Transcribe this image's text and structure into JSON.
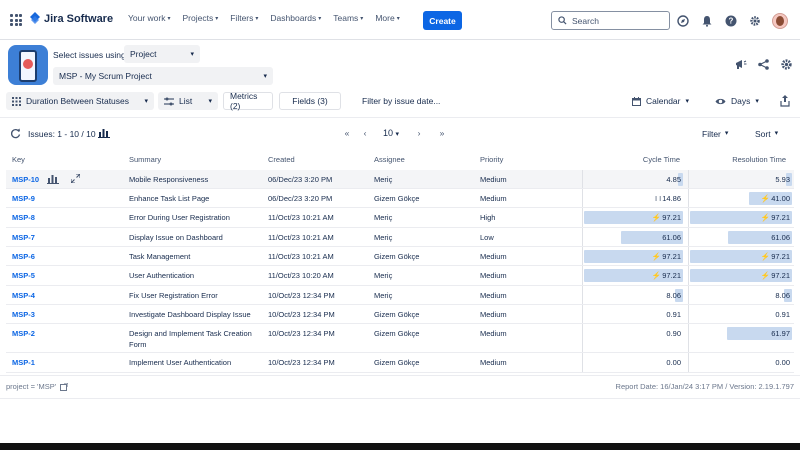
{
  "topnav": {
    "logo_text": "Jira Software",
    "items": [
      {
        "label": "Your work"
      },
      {
        "label": "Projects"
      },
      {
        "label": "Filters"
      },
      {
        "label": "Dashboards"
      },
      {
        "label": "Teams"
      },
      {
        "label": "More"
      }
    ],
    "create_label": "Create",
    "search_placeholder": "Search"
  },
  "header": {
    "select_label": "Select issues using",
    "source_value": "Project",
    "project_value": "MSP - My Scrum Project"
  },
  "toolbar": {
    "report_label": "Duration Between Statuses",
    "view_label": "List",
    "metrics_label": "Metrics (2)",
    "fields_label": "Fields (3)",
    "filter_date_label": "Filter by issue date...",
    "calendar_label": "Calendar",
    "unit_label": "Days"
  },
  "issues_bar": {
    "count_label": "Issues: 1 - 10 / 10",
    "page_size": "10",
    "filter_label": "Filter",
    "sort_label": "Sort"
  },
  "table": {
    "headers": {
      "key": "Key",
      "summary": "Summary",
      "created": "Created",
      "assignee": "Assignee",
      "priority": "Priority",
      "cycle": "Cycle Time",
      "resolution": "Resolution Time"
    },
    "rows": [
      {
        "key": "MSP-10",
        "summary": "Mobile Responsiveness",
        "summary2": "",
        "created": "06/Dec/23 3:20 PM",
        "assignee": "Meriç",
        "priority": "Medium",
        "cycle": "4.85",
        "cycle_frac": 0.05,
        "cycle_icon": false,
        "resolution": "5.93",
        "res_frac": 0.06,
        "res_icon": false
      },
      {
        "key": "MSP-9",
        "summary": "Enhance Task List Page",
        "summary2": "",
        "created": "06/Dec/23 3:20 PM",
        "assignee": "Gizem Gökçe",
        "priority": "Medium",
        "cycle": "14.86",
        "cycle_frac": 0.0,
        "cycle_icon": false,
        "cycle_prefix": "I I",
        "resolution": "41.00",
        "res_frac": 0.42,
        "res_icon": true
      },
      {
        "key": "MSP-8",
        "summary": "Error During User Registration",
        "summary2": "",
        "created": "11/Oct/23 10:21 AM",
        "assignee": "Meriç",
        "priority": "High",
        "cycle": "97.21",
        "cycle_frac": 1.0,
        "cycle_icon": true,
        "resolution": "97.21",
        "res_frac": 1.0,
        "res_icon": true
      },
      {
        "key": "MSP-7",
        "summary": "Display Issue on Dashboard",
        "summary2": "",
        "created": "11/Oct/23 10:21 AM",
        "assignee": "Meriç",
        "priority": "Low",
        "cycle": "61.06",
        "cycle_frac": 0.63,
        "cycle_icon": false,
        "resolution": "61.06",
        "res_frac": 0.63,
        "res_icon": false
      },
      {
        "key": "MSP-6",
        "summary": "Task Management",
        "summary2": "",
        "created": "11/Oct/23 10:21 AM",
        "assignee": "Gizem Gökçe",
        "priority": "Medium",
        "cycle": "97.21",
        "cycle_frac": 1.0,
        "cycle_icon": true,
        "resolution": "97.21",
        "res_frac": 1.0,
        "res_icon": true
      },
      {
        "key": "MSP-5",
        "summary": "User Authentication",
        "summary2": "",
        "created": "11/Oct/23 10:20 AM",
        "assignee": "Meriç",
        "priority": "Medium",
        "cycle": "97.21",
        "cycle_frac": 1.0,
        "cycle_icon": true,
        "resolution": "97.21",
        "res_frac": 1.0,
        "res_icon": true
      },
      {
        "key": "MSP-4",
        "summary": "Fix User Registration Error",
        "summary2": "",
        "created": "10/Oct/23 12:34 PM",
        "assignee": "Meriç",
        "priority": "Medium",
        "cycle": "8.06",
        "cycle_frac": 0.08,
        "cycle_icon": false,
        "resolution": "8.06",
        "res_frac": 0.08,
        "res_icon": false
      },
      {
        "key": "MSP-3",
        "summary": "Investigate Dashboard Display Issue",
        "summary2": "",
        "created": "10/Oct/23 12:34 PM",
        "assignee": "Gizem Gökçe",
        "priority": "Medium",
        "cycle": "0.91",
        "cycle_frac": 0.0,
        "cycle_icon": false,
        "resolution": "0.91",
        "res_frac": 0.0,
        "res_icon": false
      },
      {
        "key": "MSP-2",
        "summary": "Design and Implement Task Creation",
        "summary2": "Form",
        "created": "10/Oct/23 12:34 PM",
        "assignee": "Gizem Gökçe",
        "priority": "Medium",
        "cycle": "0.90",
        "cycle_frac": 0.0,
        "cycle_icon": false,
        "resolution": "61.97",
        "res_frac": 0.64,
        "res_icon": false
      },
      {
        "key": "MSP-1",
        "summary": "Implement User Authentication",
        "summary2": "",
        "created": "10/Oct/23 12:34 PM",
        "assignee": "Gizem Gökçe",
        "priority": "Medium",
        "cycle": "0.00",
        "cycle_frac": 0.0,
        "cycle_icon": false,
        "resolution": "0.00",
        "res_frac": 0.0,
        "res_icon": false
      }
    ]
  },
  "footer": {
    "jql": "project = 'MSP'",
    "report_info": "Report Date: 16/Jan/24 3:17 PM / Version: 2.19.1.797"
  },
  "colors": {
    "accent": "#0c66e4",
    "bar": "#c8d9ef"
  }
}
